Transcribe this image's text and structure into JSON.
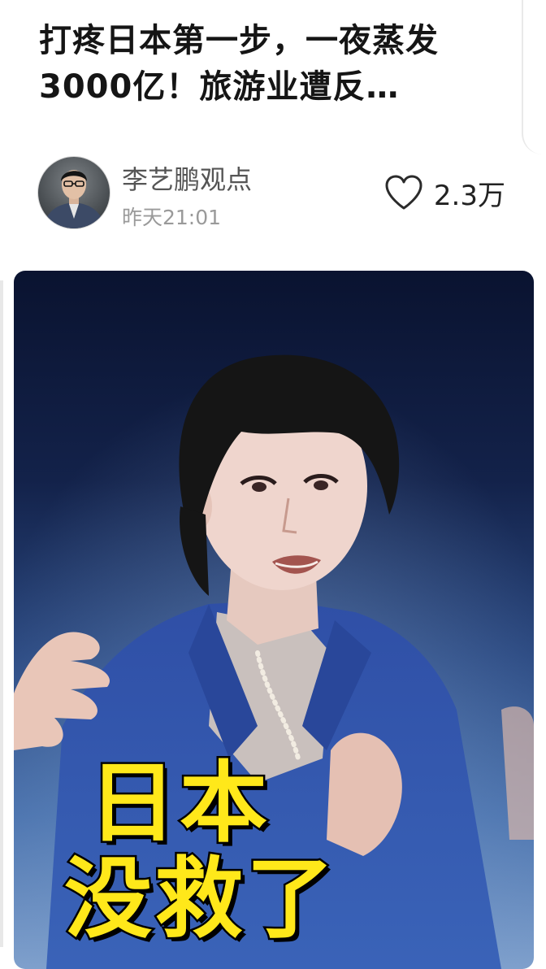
{
  "article": {
    "title": "打疼日本第一步，一夜蒸发3000亿！旅游业遭反…"
  },
  "author": {
    "name": "李艺鹏观点",
    "time": "昨天21:01",
    "avatar_icon": "author-avatar"
  },
  "stats": {
    "like_icon": "heart-outline-icon",
    "likes": "2.3万"
  },
  "cover": {
    "caption_line1": "日本",
    "caption_line2": "没救了",
    "caption_color": "#ffe81a",
    "background_colors": [
      "#0a1330",
      "#2a4880",
      "#7fa0cc"
    ]
  }
}
